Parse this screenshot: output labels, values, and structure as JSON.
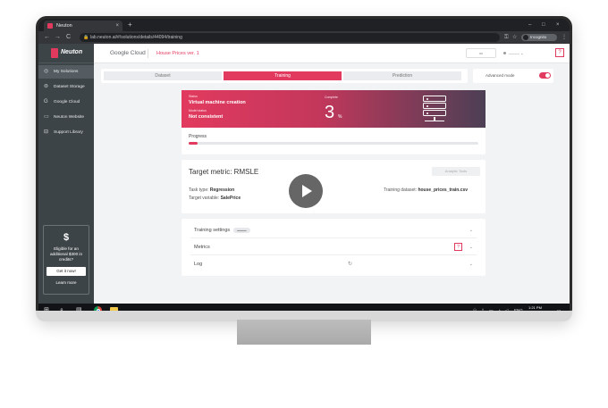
{
  "browser": {
    "tab_title": "Neuton",
    "tab_close": "×",
    "new_tab": "+",
    "minimize": "–",
    "maximize": "□",
    "close": "×",
    "back": "←",
    "forward": "→",
    "reload": "C",
    "url": "lab.neuton.ai/#/solutions/details/44094/training",
    "incognito_label": "Incognito",
    "menu": "⋮"
  },
  "sidebar": {
    "logo": "Neuton",
    "items": [
      {
        "label": "My Solutions",
        "icon": "◎"
      },
      {
        "label": "Dataset Storage",
        "icon": "⊜"
      },
      {
        "label": "Google Cloud",
        "icon": "G"
      },
      {
        "label": "Neuton Website",
        "icon": "▭"
      },
      {
        "label": "Support Library",
        "icon": "⊟"
      }
    ],
    "promo": {
      "symbol": "$",
      "text": "Eligible for an additional $300 in credits?",
      "button": "Get it now!",
      "link": "Learn more"
    }
  },
  "topbar": {
    "google_cloud": "Google Cloud",
    "project": "House Prices ver. 1",
    "help": "?"
  },
  "steps": [
    "Dataset",
    "Training",
    "Prediction"
  ],
  "active_step": 1,
  "advanced_mode_label": "Advanced mode",
  "status": {
    "status_label": "Status",
    "status_value": "Virtual machine creation",
    "model_status_label": "Model status",
    "model_status_value": "Not consistent",
    "complete_label": "Complete",
    "complete_value": "3",
    "complete_unit": "%"
  },
  "progress": {
    "label": "Progress",
    "fraction": 0.03
  },
  "metric": {
    "title": "Target metric:  RMSLE",
    "analytic_tools": "Analytic Tools",
    "task_type_label": "Task type:",
    "task_type_value": "Regression",
    "target_variable_label": "Target variable:",
    "target_variable_value": "SalePrice",
    "training_dataset_label": "Training dataset:",
    "training_dataset_value": "house_prices_train.csv"
  },
  "accordion": [
    {
      "label": "Training settings",
      "chevron": "⌄"
    },
    {
      "label": "Metrics",
      "chevron": "⌄",
      "help": "?"
    },
    {
      "label": "Log",
      "chevron": "⌄"
    }
  ],
  "taskbar": {
    "windows_icon": "windows-icon",
    "search_icon": "search-icon",
    "taskview_icon": "taskview-icon",
    "tray_lang": "ENG",
    "time": "1:21 PM"
  },
  "colors": {
    "accent": "#e23a5f",
    "sidebar": "#3d4448"
  }
}
